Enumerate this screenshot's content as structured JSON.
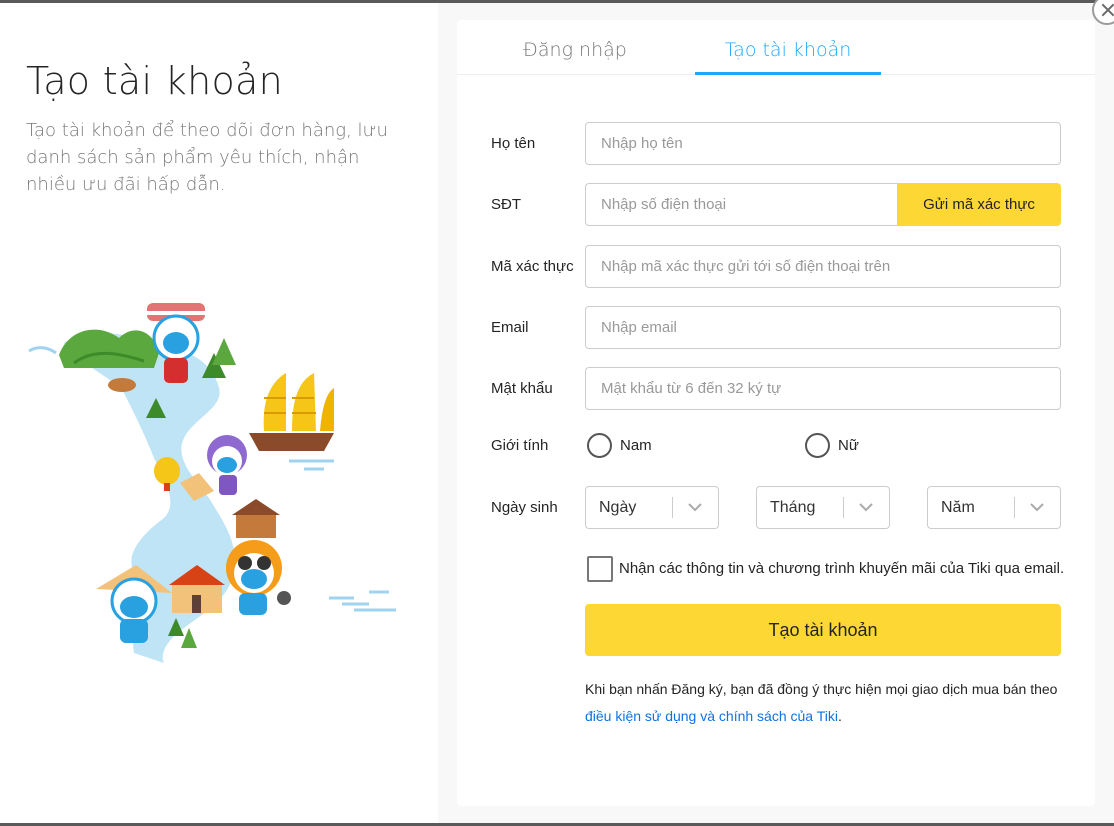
{
  "left": {
    "title": "Tạo tài khoản",
    "description": "Tạo tài khoản để theo dõi đơn hàng, lưu danh sách sản phẩm yêu thích, nhận nhiều ưu đãi hấp dẫn."
  },
  "tabs": {
    "login": "Đăng nhập",
    "signup": "Tạo tài khoản",
    "active": "signup"
  },
  "form": {
    "name": {
      "label": "Họ tên",
      "placeholder": "Nhập họ tên",
      "value": ""
    },
    "phone": {
      "label": "SĐT",
      "placeholder": "Nhập số điện thoại",
      "value": "",
      "send_otp": "Gửi mã xác thực"
    },
    "otp": {
      "label": "Mã xác thực",
      "placeholder": "Nhập mã xác thực gửi tới số điện thoại trên",
      "value": ""
    },
    "email": {
      "label": "Email",
      "placeholder": "Nhập email",
      "value": ""
    },
    "password": {
      "label": "Mật khẩu",
      "placeholder": "Mật khẩu từ 6 đến 32 ký tự",
      "value": ""
    },
    "gender": {
      "label": "Giới tính",
      "male": "Nam",
      "female": "Nữ"
    },
    "birthday": {
      "label": "Ngày sinh",
      "day": "Ngày",
      "month": "Tháng",
      "year": "Năm"
    },
    "newsletter": "Nhận các thông tin và chương trình khuyến mãi của Tiki qua email.",
    "submit": "Tạo tài khoản",
    "terms_prefix": "Khi bạn nhấn Đăng ký, bạn đã đồng ý thực hiện mọi giao dịch mua bán theo",
    "terms_link": "điều kiện sử dụng và chính sách của Tiki",
    "terms_suffix": "."
  },
  "colors": {
    "accent_blue": "#1ba8ff",
    "button_yellow": "#fdd835",
    "link_blue": "#0b74e5"
  }
}
